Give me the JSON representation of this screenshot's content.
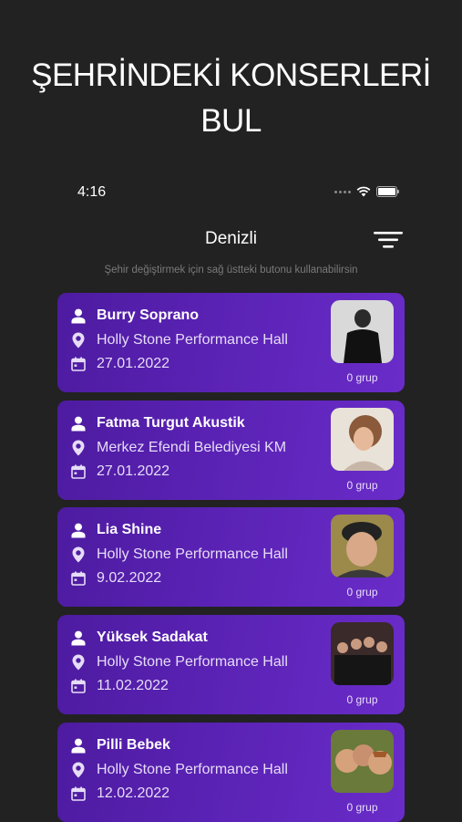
{
  "headline": {
    "line1": "ŞEHRİNDEKİ KONSERLERİ",
    "line2": "BUL"
  },
  "status_bar": {
    "time": "4:16"
  },
  "header": {
    "city": "Denizli",
    "filter_icon": "filter-lines-icon"
  },
  "hint": "Şehir değiştirmek için sağ üstteki butonu kullanabilirsin",
  "concerts": [
    {
      "artist": "Burry Soprano",
      "venue": "Holly Stone Performance Hall",
      "date": "27.01.2022",
      "groups": "0 grup"
    },
    {
      "artist": "Fatma Turgut Akustik",
      "venue": "Merkez Efendi Belediyesi KM",
      "date": "27.01.2022",
      "groups": "0 grup"
    },
    {
      "artist": "Lia Shine",
      "venue": "Holly Stone Performance Hall",
      "date": "9.02.2022",
      "groups": "0 grup"
    },
    {
      "artist": "Yüksek Sadakat",
      "venue": "Holly Stone Performance Hall",
      "date": "11.02.2022",
      "groups": "0 grup"
    },
    {
      "artist": "Pilli Bebek",
      "venue": "Holly Stone Performance Hall",
      "date": "12.02.2022",
      "groups": "0 grup"
    }
  ],
  "colors": {
    "background": "#222222",
    "card_start": "#4d1ba0",
    "card_end": "#6a2cc9",
    "hint": "#7a7a7a"
  }
}
